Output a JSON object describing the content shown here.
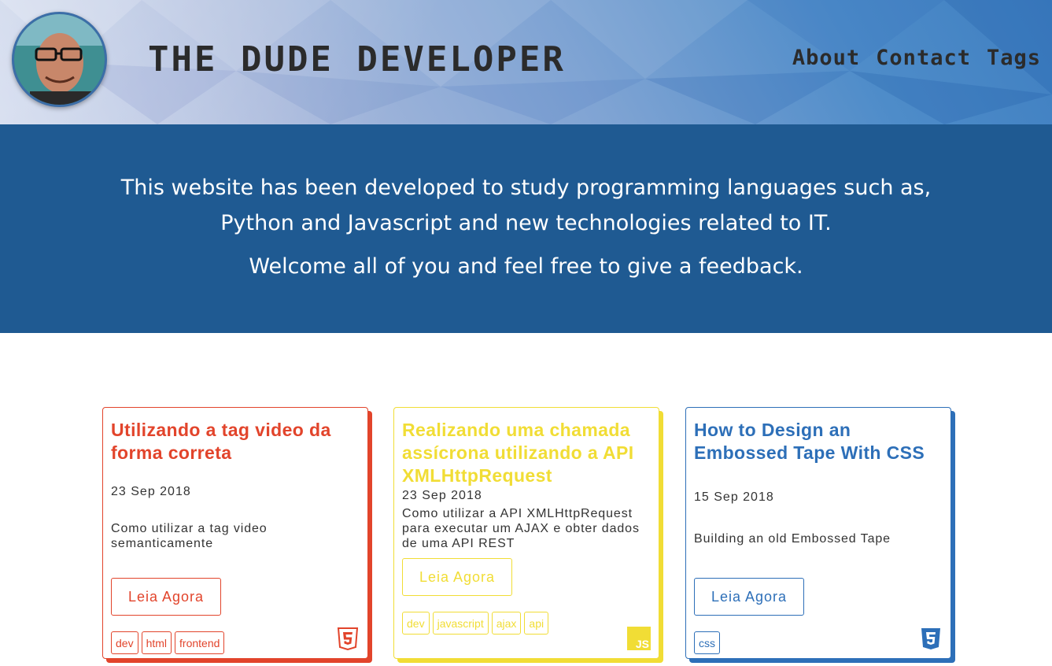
{
  "header": {
    "title": "THE DUDE DEVELOPER",
    "nav": [
      {
        "label": "About"
      },
      {
        "label": "Contact"
      },
      {
        "label": "Tags"
      }
    ]
  },
  "intro": {
    "line1": "This website has been developed to study programming languages such as, Python and Javascript and new technologies related to IT.",
    "line2": "Welcome all of you and feel free to give a feedback."
  },
  "posts": [
    {
      "title": "Utilizando a tag video da forma correta",
      "date": "23 Sep 2018",
      "description": "Como utilizar a tag video semanticamente",
      "button": "Leia Agora",
      "tags": [
        "dev",
        "html",
        "frontend"
      ],
      "icon": "html5-icon",
      "color": "#e2442b"
    },
    {
      "title": "Realizando uma chamada assícrona utilizando a API XMLHttpRequest",
      "date": "23 Sep 2018",
      "description": "Como utilizar a API XMLHttpRequest para executar um AJAX e obter dados de uma API REST",
      "button": "Leia Agora",
      "tags": [
        "dev",
        "javascript",
        "ajax",
        "api"
      ],
      "icon": "javascript-icon",
      "icon_text": "JS",
      "color": "#f1dd35"
    },
    {
      "title": "How to Design an Embossed Tape With CSS",
      "date": "15 Sep 2018",
      "description": "Building an old Embossed Tape",
      "button": "Leia Agora",
      "tags": [
        "css"
      ],
      "icon": "css3-icon",
      "color": "#2d6fb8"
    }
  ],
  "colors": {
    "header_text": "#2b2b2b",
    "intro_bg": "#1f5a92"
  }
}
